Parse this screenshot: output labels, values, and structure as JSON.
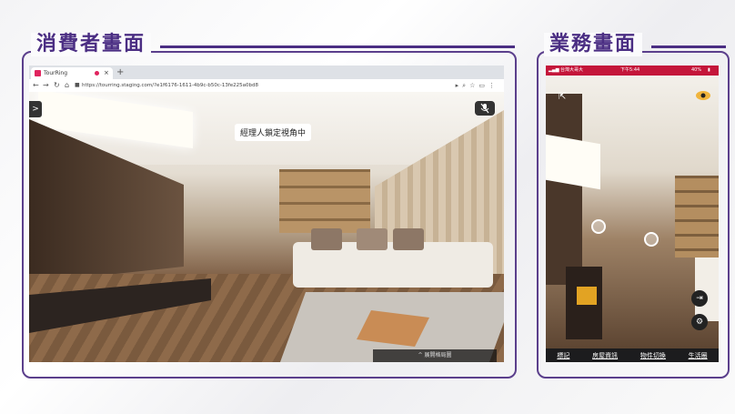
{
  "consumer": {
    "title": "消費者畫面"
  },
  "sales": {
    "title": "業務畫面"
  },
  "browser": {
    "tab_title": "TourRing",
    "tab_close": "×",
    "new_tab": "+",
    "url": "https://tourring.staging.com/?e1f6176-1611-4b9c-b50c-13fe225a0bd8",
    "lock_banner": "經理人鎖定視角中",
    "side_button": ">",
    "bottom_bar": "^ 展開格局圖"
  },
  "phone": {
    "carrier": "台灣大哥大",
    "time": "下午5:44",
    "battery": "40%",
    "tabs": [
      "標記",
      "房屋資訊",
      "物件切換",
      "生活圈"
    ]
  },
  "colors": {
    "accent": "#4b2e83",
    "frame": "#5b3f8c",
    "status_bar": "#c4163a",
    "eye_icon": "#f0b43c"
  }
}
